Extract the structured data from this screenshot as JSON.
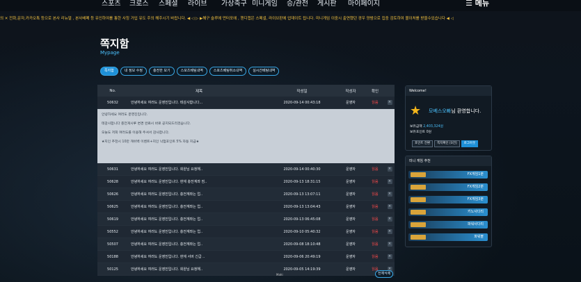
{
  "topnav": {
    "items": [
      "스포츠",
      "크로스",
      "스페셜",
      "라이브",
      "가상축구",
      "미니게임",
      "승/관전",
      "게시판",
      "마이페이지"
    ],
    "menu_label": "☰ 메뉴"
  },
  "ticker": "의 ✕ 전화,문자,카카오톡 등으로 본사 리뉴얼 , 본사배폐 등 유인하여를 통한 사칭 거입 유도 주의 해주시기 바랍니다. ◀ ◁ ▷ ▶해구 슬루에 먼터포에 , 핸디캡은 스페셜, 라이브판에 업데이트 됩니다. 미니게임 이중시 출연했던 경우 양범으로 집중 검토하여 몰이처를 받을수있습니다 ◀ ◁",
  "page": {
    "title": "쪽지함",
    "subtitle": "Mypage"
  },
  "tabs": [
    "쪽지함",
    "내 정보 수정",
    "충전한 보기",
    "스포츠베팅내역",
    "스포츠베팅취소내역",
    "실시간베팅내역"
  ],
  "table": {
    "headers": {
      "no": "No.",
      "title": "제목",
      "date": "작성일",
      "writer": "작성자",
      "status": "확인"
    },
    "first_row": {
      "no": "50632",
      "title": "안녕하세요 여러도 운영진입니다. 테감사합니다...",
      "date": "2020-09-14 00:43:18",
      "writer": "운영자",
      "status": "읽음"
    },
    "expanded_lines": [
      "안녕하세요 여러도 운영진입니다.",
      "테감사합니다 충전게시루 변경 완료시 바로 공지되드리겠습니다.",
      "오늘도 저희 여러도를 이용해 주셔서 감사합니다.",
      "★지인 추천시 10만 캐쉬백 이벤트+지인 낙첨포인트 5% 자동 지급★"
    ],
    "rows": [
      {
        "no": "50631",
        "title": "안녕하세요 여러도 운영진입니다. 회원님 요청해..",
        "date": "2020-09-14 00:40:30",
        "writer": "운영자",
        "status": "읽음"
      },
      {
        "no": "50628",
        "title": "안녕하세요 여러도 운영진입니다. 현재 충전계좌 점..",
        "date": "2020-09-13 18:31:15",
        "writer": "운영자",
        "status": "읽음"
      },
      {
        "no": "50626",
        "title": "안녕하세요 여러도 운영진입니다. 충전계좌는 업..",
        "date": "2020-09-13 13:07:11",
        "writer": "운영자",
        "status": "읽음"
      },
      {
        "no": "50625",
        "title": "안녕하세요 여러도 운영진입니다. 충전계좌는 업..",
        "date": "2020-09-13 13:04:43",
        "writer": "운영자",
        "status": "읽음"
      },
      {
        "no": "50619",
        "title": "안녕하세요 여러도 운영진입니다. 충전계좌는 업..",
        "date": "2020-09-13 06:45:08",
        "writer": "운영자",
        "status": "읽음"
      },
      {
        "no": "50552",
        "title": "안녕하세요 여러도 운영진입니다. 충전계좌는 업..",
        "date": "2020-09-10 05:40:32",
        "writer": "운영자",
        "status": "읽음"
      },
      {
        "no": "50507",
        "title": "안녕하세요 여러도 운영진입니다. 충전계좌는 업..",
        "date": "2020-09-08 18:10:48",
        "writer": "운영자",
        "status": "읽음"
      },
      {
        "no": "50188",
        "title": "안녕하세요 여러도 운영진입니다. 현재 서버 긴급 ..",
        "date": "2020-09-06 20:49:19",
        "writer": "운영자",
        "status": "읽음"
      },
      {
        "no": "50125",
        "title": "안녕하세요 여러도 운영진입니다. 회원님 요청해..",
        "date": "2020-09-05 14:19:39",
        "writer": "운영자",
        "status": "읽음"
      }
    ]
  },
  "pager": "Mahi",
  "delete_all": "전체삭제",
  "user": {
    "welcome_label": "Welcome!",
    "name": "모베스오빠",
    "welcome_suffix": "님 환영합니다.",
    "money_label": "보유금액",
    "money_value": "2,403,324원",
    "point_label": "보유포인트",
    "point_value": "0원",
    "buttons": [
      "포인트 전환",
      "쪽지확인 [0건]",
      "로그아웃"
    ]
  },
  "mini": {
    "header": "미니 게임 추천",
    "games": [
      "FX게임1분",
      "FX게임2분",
      "FX게임3분",
      "키노사다리",
      "파워사다리",
      "파워볼"
    ]
  }
}
